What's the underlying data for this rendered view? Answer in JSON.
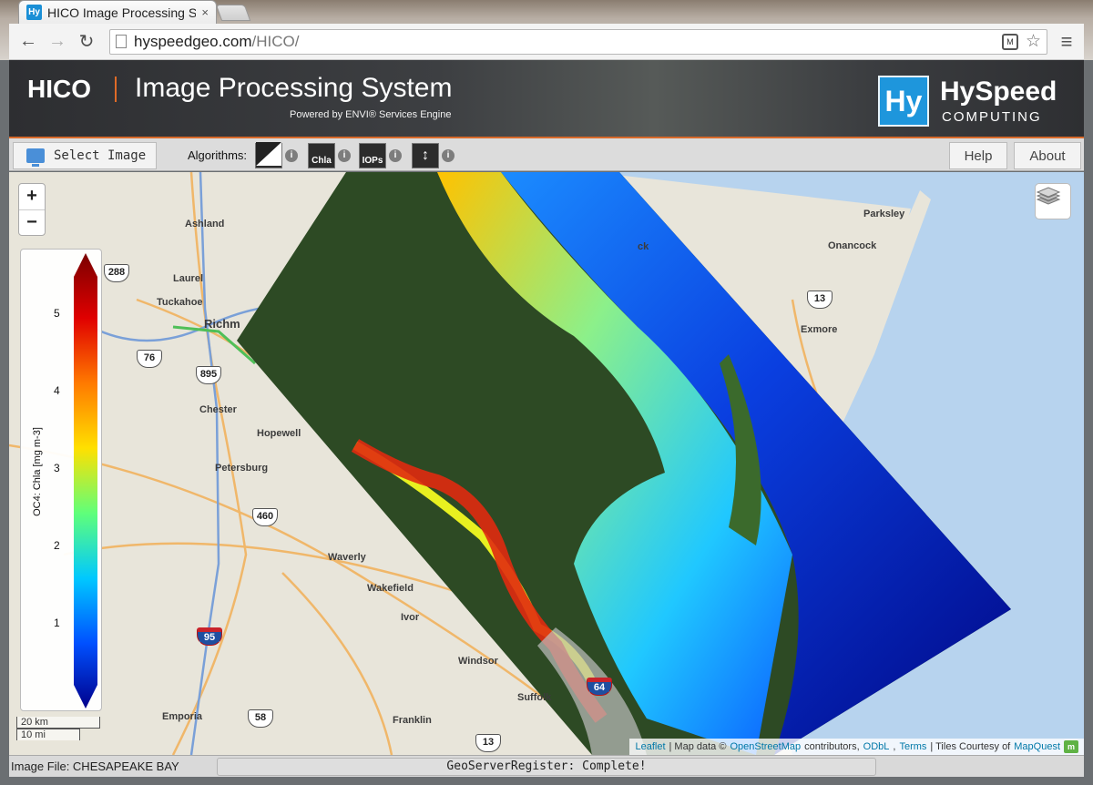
{
  "browser": {
    "tab_title": "HICO Image Processing Sy",
    "tab_favicon": "Hy",
    "tab_close": "×",
    "url_host": "hyspeedgeo.com",
    "url_path": "/HICO/",
    "back_icon": "arrow-left-icon",
    "forward_icon": "arrow-right-icon",
    "reload_icon": "reload-icon"
  },
  "header": {
    "title_short": "HICO",
    "title_long": "Image Processing System",
    "powered_by": "Powered by ENVI® Services Engine",
    "logo_mark": "Hy",
    "logo_title": "HySpeed",
    "logo_subtitle": "COMPUTING"
  },
  "toolbar": {
    "select_image": "Select Image",
    "algorithms_label": "Algorithms:",
    "algorithms": [
      {
        "label": "",
        "icon": "diagonal-split-icon"
      },
      {
        "label": "Chla",
        "icon": "chla-icon"
      },
      {
        "label": "IOPs",
        "icon": "iops-icon"
      },
      {
        "label": "",
        "icon": "arrows-icon"
      }
    ],
    "info_glyph": "i",
    "help": "Help",
    "about": "About"
  },
  "map": {
    "zoom_in": "+",
    "zoom_out": "−",
    "places": [
      {
        "name": "Ashland"
      },
      {
        "name": "Laurel"
      },
      {
        "name": "Tuckahoe"
      },
      {
        "name": "Richm"
      },
      {
        "name": "Chester"
      },
      {
        "name": "Hopewell"
      },
      {
        "name": "Petersburg"
      },
      {
        "name": "Waverly"
      },
      {
        "name": "Wakefield"
      },
      {
        "name": "Ivor"
      },
      {
        "name": "Windsor"
      },
      {
        "name": "Suffolk"
      },
      {
        "name": "Emporia"
      },
      {
        "name": "Franklin"
      },
      {
        "name": "Parksley"
      },
      {
        "name": "Onancock"
      },
      {
        "name": "Exmore"
      },
      {
        "name": "ck"
      }
    ],
    "shields": [
      {
        "label": "288"
      },
      {
        "label": "76"
      },
      {
        "label": "895"
      },
      {
        "label": "460"
      },
      {
        "label": "95"
      },
      {
        "label": "58"
      },
      {
        "label": "13"
      },
      {
        "label": "13"
      },
      {
        "label": "64"
      }
    ],
    "legend": {
      "title": "OC4: Chla [mg m-3]",
      "ticks": [
        "5",
        "4",
        "3",
        "2",
        "1"
      ],
      "colors": [
        "#7a0000",
        "#e00000",
        "#ff7a00",
        "#ffe000",
        "#5fff7a",
        "#00c8ff",
        "#0050ff",
        "#00008b"
      ]
    },
    "scale_km": "20 km",
    "scale_mi": "10 mi",
    "attribution": {
      "leaflet": "Leaflet",
      "sep1": "| Map data ©",
      "osm": "OpenStreetMap",
      "contributors": "contributors,",
      "odbl": "ODbL",
      "comma": ",",
      "terms": "Terms",
      "tiles": "| Tiles Courtesy of",
      "mapquest": "MapQuest",
      "mq_icon": "m"
    }
  },
  "status": {
    "image_file": "Image File: CHESAPEAKE BAY",
    "message": "GeoServerRegister: Complete!"
  }
}
